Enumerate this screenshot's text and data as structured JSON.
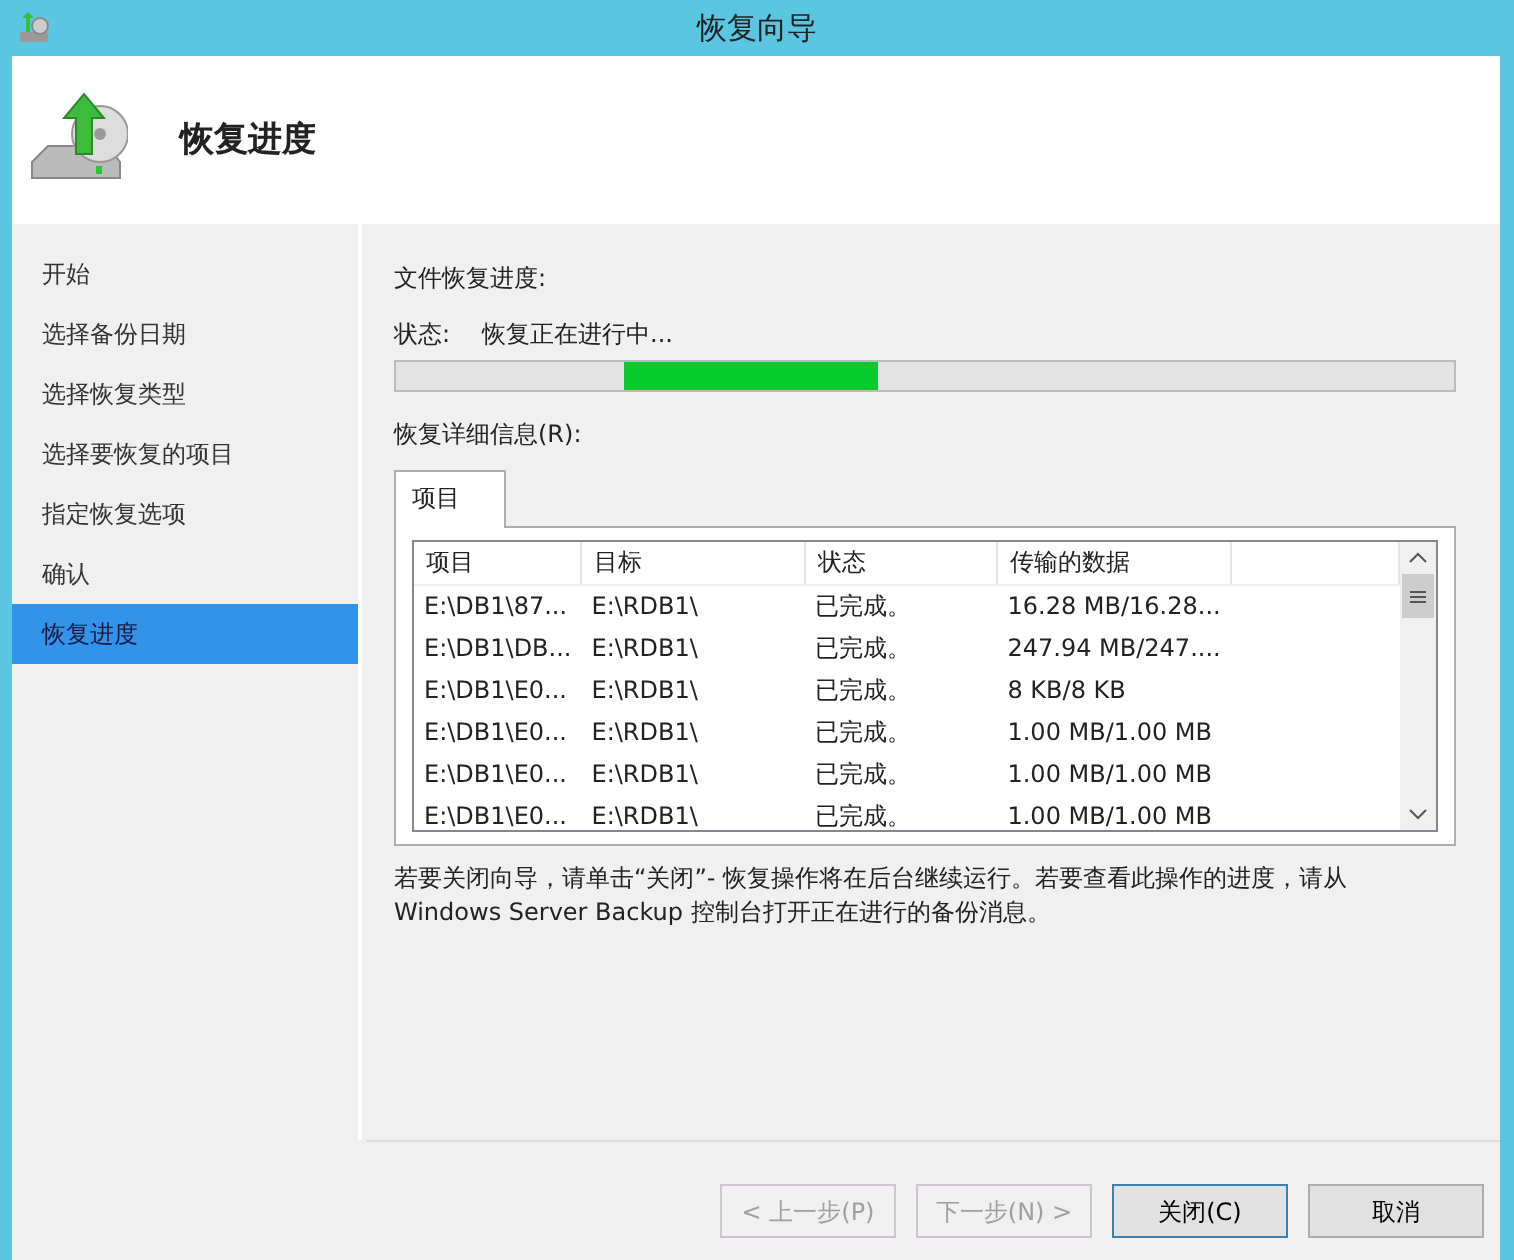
{
  "window": {
    "title": "恢复向导"
  },
  "header": {
    "title": "恢复进度"
  },
  "sidebar": {
    "items": [
      {
        "label": "开始",
        "selected": false
      },
      {
        "label": "选择备份日期",
        "selected": false
      },
      {
        "label": "选择恢复类型",
        "selected": false
      },
      {
        "label": "选择要恢复的项目",
        "selected": false
      },
      {
        "label": "指定恢复选项",
        "selected": false
      },
      {
        "label": "确认",
        "selected": false
      },
      {
        "label": "恢复进度",
        "selected": true
      }
    ]
  },
  "progress": {
    "heading": "文件恢复进度:",
    "status_label": "状态:",
    "status": "恢复正在进行中...",
    "indeterminate": true
  },
  "details": {
    "label": "恢复详细信息(R):",
    "tabs": [
      {
        "label": "项目",
        "selected": true
      }
    ],
    "table": {
      "columns": [
        "项目",
        "目标",
        "状态",
        "传输的数据"
      ],
      "rows": [
        [
          "E:\\DB1\\87...",
          "E:\\RDB1\\",
          "已完成。",
          "16.28 MB/16.28..."
        ],
        [
          "E:\\DB1\\DB...",
          "E:\\RDB1\\",
          "已完成。",
          "247.94 MB/247...."
        ],
        [
          "E:\\DB1\\E0...",
          "E:\\RDB1\\",
          "已完成。",
          "8 KB/8 KB"
        ],
        [
          "E:\\DB1\\E0...",
          "E:\\RDB1\\",
          "已完成。",
          "1.00 MB/1.00 MB"
        ],
        [
          "E:\\DB1\\E0...",
          "E:\\RDB1\\",
          "已完成。",
          "1.00 MB/1.00 MB"
        ],
        [
          "E:\\DB1\\E0...",
          "E:\\RDB1\\",
          "已完成。",
          "1.00 MB/1.00 MB"
        ]
      ]
    }
  },
  "note": "若要关闭向导，请单击“关闭”- 恢复操作将在后台继续运行。若要查看此操作的进度，请从 Windows Server Backup 控制台打开正在进行的备份消息。",
  "buttons": [
    {
      "label": "< 上一步(P)",
      "disabled": true,
      "default": false
    },
    {
      "label": "下一步(N) >",
      "disabled": true,
      "default": false
    },
    {
      "label": "关闭(C)",
      "disabled": false,
      "default": true
    },
    {
      "label": "取消",
      "disabled": false,
      "default": false
    }
  ]
}
